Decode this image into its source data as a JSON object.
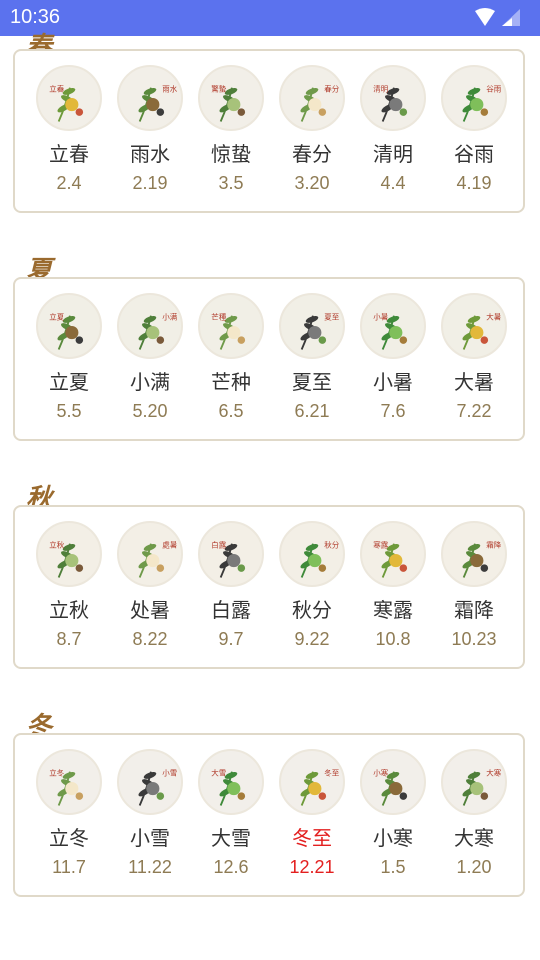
{
  "status_bar": {
    "time": "10:36",
    "icons": [
      "wifi-icon",
      "signal-icon"
    ]
  },
  "colors": {
    "status_bar": "#5b72ee",
    "card_border": "#e0d9c9",
    "date_text": "#8e7b54",
    "highlight": "#e31f1f",
    "season_tag": "#9a6a2e"
  },
  "seasons": [
    {
      "tag": "春",
      "terms": [
        {
          "name": "立春",
          "date": "2.4",
          "icon": "lichun-bird-flower-icon",
          "icon_text": "立春"
        },
        {
          "name": "雨水",
          "date": "2.19",
          "icon": "yushui-willow-icon",
          "icon_text": "雨水"
        },
        {
          "name": "惊蛰",
          "date": "3.5",
          "icon": "jingzhe-bamboo-icon",
          "icon_text": "驚蟄"
        },
        {
          "name": "春分",
          "date": "3.20",
          "icon": "chunfen-magnolia-icon",
          "icon_text": "春分"
        },
        {
          "name": "清明",
          "date": "4.4",
          "icon": "qingming-village-icon",
          "icon_text": "清明"
        },
        {
          "name": "谷雨",
          "date": "4.19",
          "icon": "guyu-tea-leaf-icon",
          "icon_text": "谷雨"
        }
      ]
    },
    {
      "tag": "夏",
      "terms": [
        {
          "name": "立夏",
          "date": "5.5",
          "icon": "lixia-dumplings-icon",
          "icon_text": "立夏"
        },
        {
          "name": "小满",
          "date": "5.20",
          "icon": "xiaoman-berries-icon",
          "icon_text": "小满"
        },
        {
          "name": "芒种",
          "date": "6.5",
          "icon": "mangzhong-grain-icon",
          "icon_text": "芒種"
        },
        {
          "name": "夏至",
          "date": "6.21",
          "icon": "xiazhi-pond-icon",
          "icon_text": "夏至"
        },
        {
          "name": "小暑",
          "date": "7.6",
          "icon": "xiaoshu-lychee-icon",
          "icon_text": "小暑"
        },
        {
          "name": "大暑",
          "date": "7.22",
          "icon": "dashu-watermelon-icon",
          "icon_text": "大暑"
        }
      ]
    },
    {
      "tag": "秋",
      "terms": [
        {
          "name": "立秋",
          "date": "8.7",
          "icon": "liqiu-corn-icon",
          "icon_text": "立秋"
        },
        {
          "name": "处暑",
          "date": "8.22",
          "icon": "chushu-morning-glory-icon",
          "icon_text": "處暑"
        },
        {
          "name": "白露",
          "date": "9.7",
          "icon": "bailu-pumpkin-icon",
          "icon_text": "白露"
        },
        {
          "name": "秋分",
          "date": "9.22",
          "icon": "qiufen-osmanthus-icon",
          "icon_text": "秋分"
        },
        {
          "name": "寒露",
          "date": "10.8",
          "icon": "hanlu-jar-icon",
          "icon_text": "寒露"
        },
        {
          "name": "霜降",
          "date": "10.23",
          "icon": "shuangjiang-chrysanthemum-icon",
          "icon_text": "霜降"
        }
      ]
    },
    {
      "tag": "冬",
      "terms": [
        {
          "name": "立冬",
          "date": "11.7",
          "icon": "lidong-basket-icon",
          "icon_text": "立冬"
        },
        {
          "name": "小雪",
          "date": "11.22",
          "icon": "xiaoxue-branch-icon",
          "icon_text": "小雪"
        },
        {
          "name": "大雪",
          "date": "12.6",
          "icon": "daxue-cabbage-icon",
          "icon_text": "大雪"
        },
        {
          "name": "冬至",
          "date": "12.21",
          "icon": "dongzhi-thermos-icon",
          "icon_text": "冬至",
          "highlight": true
        },
        {
          "name": "小寒",
          "date": "1.5",
          "icon": "xiaohan-plum-blossom-icon",
          "icon_text": "小寒"
        },
        {
          "name": "大寒",
          "date": "1.20",
          "icon": "dahan-porridge-icon",
          "icon_text": "大寒"
        }
      ]
    }
  ]
}
